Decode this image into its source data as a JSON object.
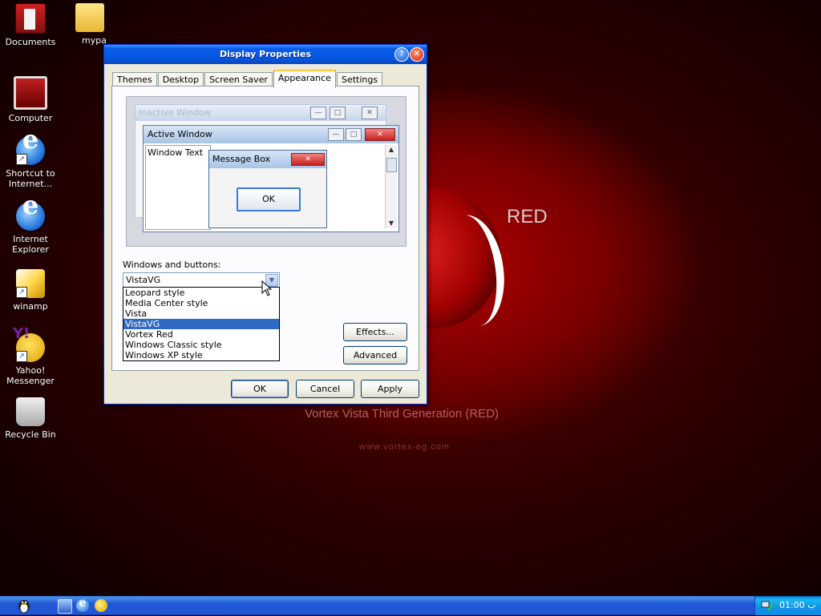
{
  "desktop": {
    "icons": [
      {
        "label": "Documents"
      },
      {
        "label": "mypa"
      },
      {
        "label": "Computer"
      },
      {
        "label": "Shortcut to Internet..."
      },
      {
        "label": "Internet Explorer"
      },
      {
        "label": "winamp"
      },
      {
        "label": "Yahoo! Messenger"
      },
      {
        "label": "Recycle Bin"
      }
    ],
    "wallpaper": {
      "brand": "RED",
      "tagline": "Vortex Vista Third Generation (RED)",
      "url": "www.vortex-eg.com"
    }
  },
  "dialog": {
    "title": "Display Properties",
    "help_glyph": "?",
    "close_glyph": "✕",
    "tabs": [
      "Themes",
      "Desktop",
      "Screen Saver",
      "Appearance",
      "Settings"
    ],
    "active_tab": "Appearance",
    "preview": {
      "inactive_title": "Inactive Window",
      "active_title": "Active Window",
      "window_text": "Window Text",
      "message_title": "Message Box",
      "message_ok": "OK"
    },
    "windows_buttons_label": "Windows and buttons:",
    "windows_buttons_value": "VistaVG",
    "style_options": [
      "Leopard style",
      "Media Center style",
      "Vista",
      "VistaVG",
      "Vortex Red",
      "Windows Classic style",
      "Windows XP style"
    ],
    "selected_option": "VistaVG",
    "effects_button": "Effects...",
    "advanced_button": "Advanced",
    "ok_button": "OK",
    "cancel_button": "Cancel",
    "apply_button": "Apply"
  },
  "taskbar": {
    "clock": "01:00 ب"
  },
  "colors": {
    "titlebar": "#0656e0",
    "selection": "#316ac5",
    "dialog_bg": "#ece9d8",
    "taskbar": "#2157d7"
  }
}
